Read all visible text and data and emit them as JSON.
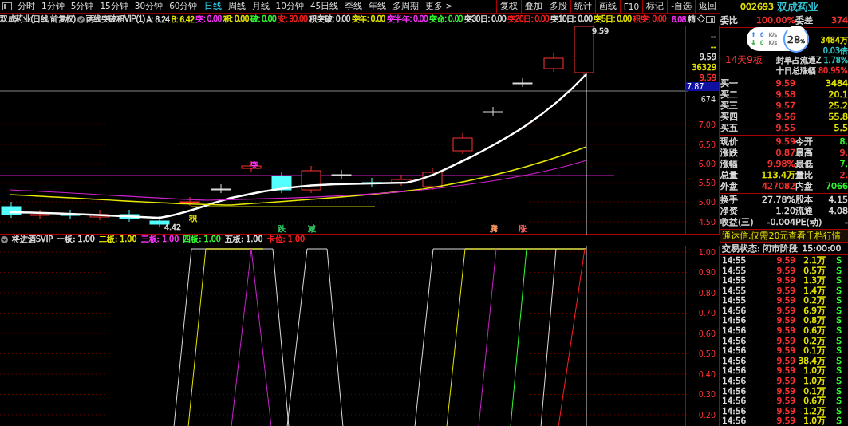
{
  "toolbar": {
    "periods": [
      {
        "label": "分时",
        "selected": false
      },
      {
        "label": "1分钟",
        "selected": false
      },
      {
        "label": "5分钟",
        "selected": false
      },
      {
        "label": "15分钟",
        "selected": false
      },
      {
        "label": "30分钟",
        "selected": false
      },
      {
        "label": "60分钟",
        "selected": false
      },
      {
        "label": "日线",
        "selected": true
      },
      {
        "label": "周线",
        "selected": false
      },
      {
        "label": "月线",
        "selected": false
      },
      {
        "label": "10分钟",
        "selected": false
      },
      {
        "label": "45日线",
        "selected": false
      },
      {
        "label": "季线",
        "selected": false
      },
      {
        "label": "年线",
        "selected": false
      },
      {
        "label": "多周期",
        "selected": false
      },
      {
        "label": "更多 >",
        "selected": false
      }
    ],
    "buttons": [
      "复权",
      "叠加",
      "多股",
      "统计",
      "画线",
      "F10",
      "标记",
      "-自选",
      "返回"
    ]
  },
  "info_bar": {
    "title": "双成药业(日线 前复权)",
    "indicator": "两线突破积VIP(1)",
    "items": [
      {
        "text": "A: 8.24",
        "color": "#e0e0e0"
      },
      {
        "text": "B: 6.42",
        "color": "#e8e800"
      },
      {
        "text": "突: 0.00",
        "color": "#ff33ff"
      },
      {
        "text": "积: 0.00",
        "color": "#e8e800"
      },
      {
        "text": "破: 0.00",
        "color": "#33ff33"
      },
      {
        "text": "安: 90.00",
        "color": "#ff2020"
      },
      {
        "text": "积突破: 0.00",
        "color": "#e0e0e0"
      },
      {
        "text": "突年: 0.00",
        "color": "#e8e800"
      },
      {
        "text": "突半年: 0.00",
        "color": "#ff33ff"
      },
      {
        "text": "突命: 0.00",
        "color": "#33ff33"
      },
      {
        "text": "突30日: 0.00",
        "color": "#e0e0e0"
      },
      {
        "text": "突20日: 0.00",
        "color": "#ff2020"
      },
      {
        "text": "突10日: 0.00",
        "color": "#e0e0e0"
      },
      {
        "text": "突5日: 0.00",
        "color": "#e8e800"
      },
      {
        "text": "积突: 0.00",
        "color": "#ff2020"
      },
      {
        "text": ": 6.08",
        "color": "#ff33ff"
      }
    ],
    "tail": "精 ◇"
  },
  "main_chart": {
    "labels": [
      {
        "text": "9.59",
        "color": "#e0e0e0"
      },
      {
        "text": "4.42",
        "color": "#e0e0e0"
      },
      {
        "text": "突",
        "color": "#ff33ff"
      },
      {
        "text": "积",
        "color": "#e8e800"
      },
      {
        "text": "跌",
        "color": "#33cc66"
      },
      {
        "text": "减",
        "color": "#33cc66"
      },
      {
        "text": "腾",
        "color": "#ff9966"
      },
      {
        "text": "涨",
        "color": "#ff6666"
      }
    ]
  },
  "price_axis": {
    "top_labels": [
      {
        "text": "--",
        "color": "#e0e0e0"
      },
      {
        "text": "--",
        "color": "#e8e800"
      },
      {
        "text": "9.59",
        "color": "#e0e0e0"
      },
      {
        "text": "36329",
        "color": "#e8e800"
      },
      {
        "text": "9.59",
        "color": "#ff3232"
      }
    ],
    "cursor_price": "7.87",
    "cursor_volume": "674",
    "ticks": [
      "7.00",
      "6.50",
      "6.00",
      "5.50",
      "5.00",
      "4.50"
    ]
  },
  "indicator_bar": {
    "title": "将进酒SVIP",
    "items": [
      {
        "text": "一板: 1.00",
        "color": "#e0e0e0"
      },
      {
        "text": "二板: 1.00",
        "color": "#e8e800"
      },
      {
        "text": "三板: 1.00",
        "color": "#ff33ff"
      },
      {
        "text": "四板: 1.00",
        "color": "#33ff33"
      },
      {
        "text": "五板: 1.00",
        "color": "#e0e0e0"
      },
      {
        "text": "卡位: 1.00",
        "color": "#ff2020"
      }
    ]
  },
  "indicator_axis": {
    "ticks": [
      "1.00",
      "0.90",
      "0.80",
      "0.70",
      "0.60",
      "0.50",
      "0.40",
      "0.30",
      "0.20"
    ]
  },
  "quote_panel": {
    "code": "002693",
    "name": "双成药业",
    "ratio": {
      "label": "委比",
      "value": "100.00%",
      "label2": "委差",
      "value2": "374"
    },
    "board_streak": "14天9板",
    "seal_info": [
      {
        "value": "3484万",
        "color": "#e8e800"
      },
      {
        "value": "0.03倍",
        "color": "#33cccc"
      },
      {
        "label": "封单占流通Z",
        "value": "1.78%",
        "color": "#33cccc"
      },
      {
        "label": "十日总涨幅",
        "value": "80.95%",
        "color": "#ff3232"
      }
    ],
    "bids": [
      {
        "label": "买一",
        "price": "9.59",
        "volume": "3484"
      },
      {
        "label": "买二",
        "price": "9.58",
        "volume": "20.1"
      },
      {
        "label": "买三",
        "price": "9.57",
        "volume": "25.2"
      },
      {
        "label": "买四",
        "price": "9.56",
        "volume": "55.8"
      },
      {
        "label": "买五",
        "price": "9.55",
        "volume": "5.5"
      }
    ],
    "quotes": [
      {
        "cells": [
          {
            "label": "现价",
            "value": "9.59",
            "color": "#ff3232"
          },
          {
            "label": "今开",
            "value": "8.",
            "color": "#33ff33"
          }
        ]
      },
      {
        "cells": [
          {
            "label": "涨跌",
            "value": "0.87",
            "color": "#ff3232"
          },
          {
            "label": "最高",
            "value": "9.",
            "color": "#ff3232"
          }
        ]
      },
      {
        "cells": [
          {
            "label": "涨幅",
            "value": "9.98%",
            "color": "#ff3232"
          },
          {
            "label": "最低",
            "value": "7.",
            "color": "#33ff33"
          }
        ]
      },
      {
        "cells": [
          {
            "label": "总量",
            "value": "113.4万",
            "color": "#e8e800"
          },
          {
            "label": "量比",
            "value": "2.",
            "color": "#ff3232"
          }
        ]
      },
      {
        "cells": [
          {
            "label": "外盘",
            "value": "427082",
            "color": "#ff3232"
          },
          {
            "label": "内盘",
            "value": "7066",
            "color": "#33ff33"
          }
        ]
      }
    ],
    "stats": [
      {
        "label": "换手",
        "value": "27.78%",
        "label2": "股本",
        "value2": "4.15"
      },
      {
        "label": "净资",
        "value": "1.20",
        "label2": "流通",
        "value2": "4.08"
      },
      {
        "label": "收益(三)",
        "value": "-0.004",
        "label2": "PE(动)",
        "value2": "-"
      }
    ],
    "banner": "通达信,仅需20元查看千档行情",
    "status": {
      "label": "交易状态: 闭市阶段",
      "time": "15:00:00"
    },
    "ticks": [
      {
        "time": "14:55",
        "price": "9.59",
        "volume": "2.1万",
        "side": "S"
      },
      {
        "time": "14:55",
        "price": "9.59",
        "volume": "0.5万",
        "side": "S"
      },
      {
        "time": "14:55",
        "price": "9.59",
        "volume": "1.3万",
        "side": "S"
      },
      {
        "time": "14:55",
        "price": "9.59",
        "volume": "1.4万",
        "side": "S"
      },
      {
        "time": "14:55",
        "price": "9.59",
        "volume": "0.2万",
        "side": "S"
      },
      {
        "time": "14:56",
        "price": "9.59",
        "volume": "6.9万",
        "side": "S"
      },
      {
        "time": "14:56",
        "price": "9.59",
        "volume": "0.8万",
        "side": "S"
      },
      {
        "time": "14:56",
        "price": "9.59",
        "volume": "0.6万",
        "side": "S"
      },
      {
        "time": "14:56",
        "price": "9.59",
        "volume": "0.2万",
        "side": "S"
      },
      {
        "time": "14:56",
        "price": "9.59",
        "volume": "0.1万",
        "side": "S"
      },
      {
        "time": "14:56",
        "price": "9.59",
        "volume": "38.4万",
        "side": "S"
      },
      {
        "time": "14:56",
        "price": "9.59",
        "volume": "1.0万",
        "side": "S"
      },
      {
        "time": "14:56",
        "price": "9.59",
        "volume": "1.0万",
        "side": "S"
      },
      {
        "time": "14:56",
        "price": "9.59",
        "volume": "0.1万",
        "side": "S"
      },
      {
        "time": "14:56",
        "price": "9.59",
        "volume": "0.6万",
        "side": "S"
      },
      {
        "time": "14:56",
        "price": "9.59",
        "volume": "1.2万",
        "side": "S"
      },
      {
        "time": "14:56",
        "price": "9.59",
        "volume": "1.0万",
        "side": "S"
      }
    ]
  },
  "net_widget": {
    "upload": "0",
    "upload_unit": "K/s",
    "download": "0",
    "download_unit": "K/s",
    "percent": "28",
    "percent_sign": "%"
  }
}
